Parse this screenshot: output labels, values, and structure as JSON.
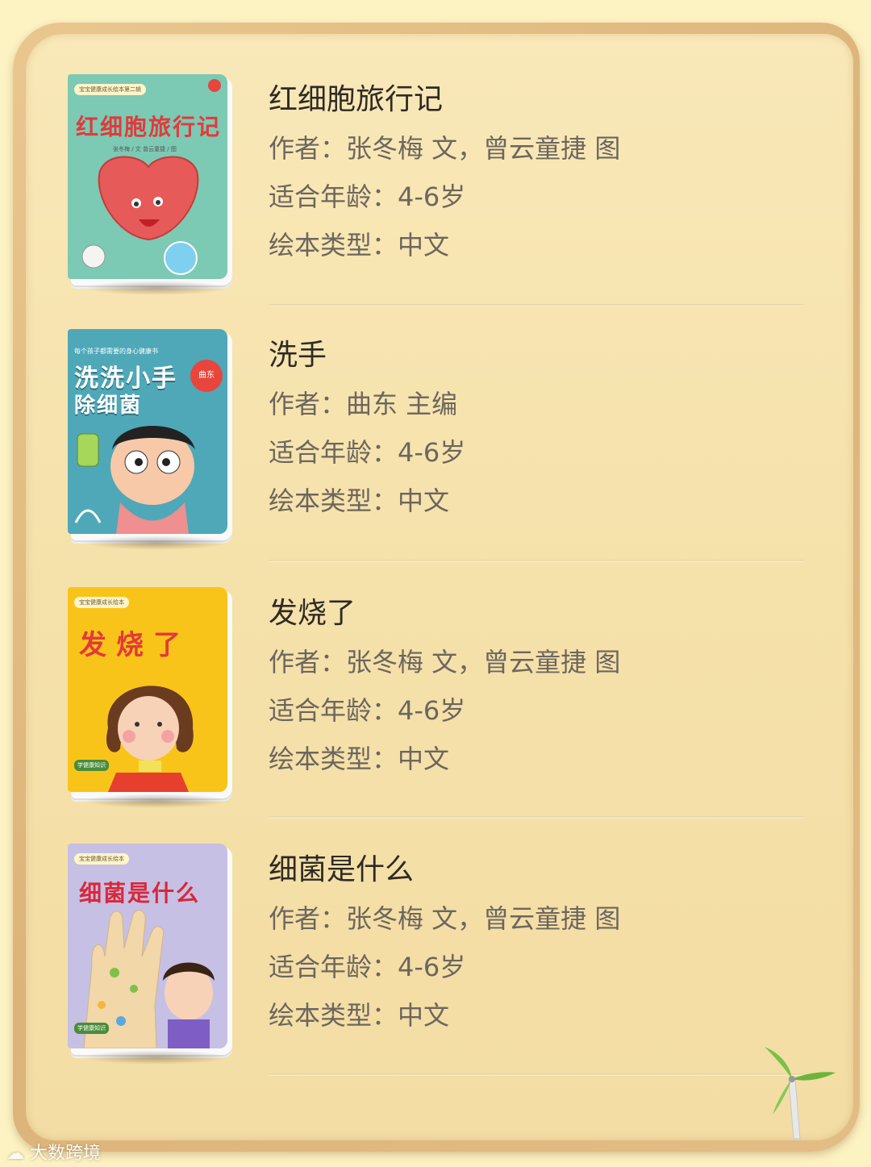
{
  "books": [
    {
      "title": "红细胞旅行记",
      "author": "作者：张冬梅 文，曾云童捷 图",
      "age": "适合年龄：4-6岁",
      "type": "绘本类型：中文",
      "cover": {
        "title": "红细胞旅行记",
        "tag": "宝宝健康成长绘本第二辑",
        "credit": "张冬梅 / 文    曾云童捷 / 图",
        "bg": "#7cc9b4",
        "title_color": "#e23a3a"
      }
    },
    {
      "title": "洗手",
      "author": "作者：曲东 主编",
      "age": "适合年龄：4-6岁",
      "type": "绘本类型：中文",
      "cover": {
        "title_line1": "洗洗小手",
        "title_line2": "除细菌",
        "tag": "每个孩子都需要的身心健康书",
        "badge": "曲东",
        "bg": "#4fa8b8",
        "title_color": "#ffffff"
      }
    },
    {
      "title": "发烧了",
      "author": "作者：张冬梅 文，曾云童捷 图",
      "age": "适合年龄：4-6岁",
      "type": "绘本类型：中文",
      "cover": {
        "title": "发烧了",
        "tag": "宝宝健康成长绘本",
        "badge": "学健康知识",
        "bg": "#f9c419",
        "title_color": "#e23a3a"
      }
    },
    {
      "title": "细菌是什么",
      "author": "作者：张冬梅 文，曾云童捷 图",
      "age": "适合年龄：4-6岁",
      "type": "绘本类型：中文",
      "cover": {
        "title": "细菌是什么",
        "tag": "宝宝健康成长绘本",
        "badge": "学健康知识",
        "bg": "#c6c0e4",
        "title_color": "#d9273a"
      }
    }
  ],
  "watermark": "大数跨境"
}
